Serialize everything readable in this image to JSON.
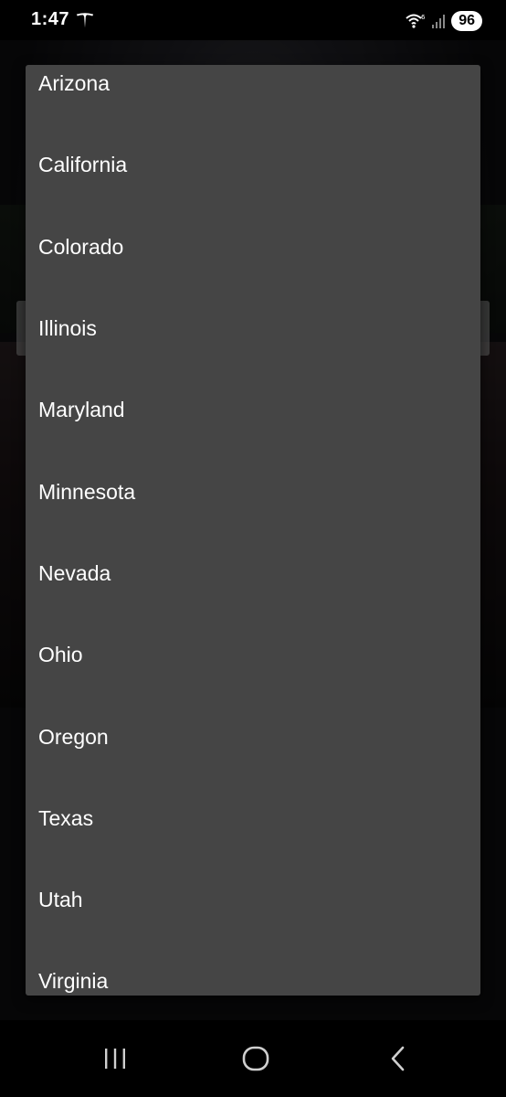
{
  "status_bar": {
    "time": "1:47",
    "carrier_icon": "tesla-logo-icon",
    "wifi_icon": "wifi-6-icon",
    "signal_icon": "cell-signal-icon",
    "battery": "96"
  },
  "state_list": {
    "items": [
      {
        "label": "Arizona"
      },
      {
        "label": "California"
      },
      {
        "label": "Colorado"
      },
      {
        "label": "Illinois"
      },
      {
        "label": "Maryland"
      },
      {
        "label": "Minnesota"
      },
      {
        "label": "Nevada"
      },
      {
        "label": "Ohio"
      },
      {
        "label": "Oregon"
      },
      {
        "label": "Texas"
      },
      {
        "label": "Utah"
      },
      {
        "label": "Virginia"
      }
    ]
  },
  "nav_bar": {
    "recent_icon": "recent-apps-icon",
    "home_icon": "home-icon",
    "back_icon": "back-icon"
  },
  "colors": {
    "panel_background": "#454545",
    "text": "#ffffff",
    "status_bar": "#000000"
  }
}
